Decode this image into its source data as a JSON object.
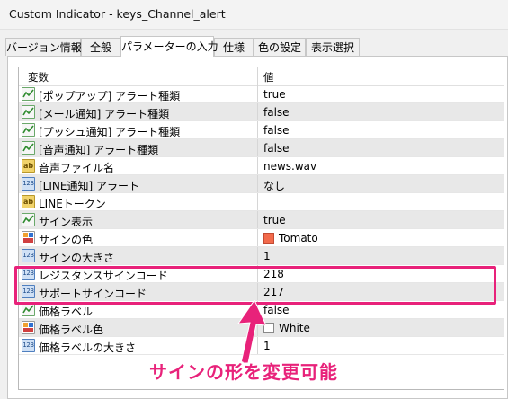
{
  "window": {
    "title": "Custom Indicator - keys_Channel_alert"
  },
  "tabs": [
    {
      "label": "バージョン情報"
    },
    {
      "label": "全般"
    },
    {
      "label": "パラメーターの入力"
    },
    {
      "label": "仕様"
    },
    {
      "label": "色の設定"
    },
    {
      "label": "表示選択"
    }
  ],
  "active_tab": "パラメーターの入力",
  "grid": {
    "headers": {
      "variable": "変数",
      "value": "値"
    },
    "rows": [
      {
        "type": "bool-icon",
        "name": "[ポップアップ] アラート種類",
        "value": "true"
      },
      {
        "type": "bool-icon",
        "name": "[メール通知] アラート種類",
        "value": "false"
      },
      {
        "type": "bool-icon",
        "name": "[プッシュ通知] アラート種類",
        "value": "false"
      },
      {
        "type": "bool-icon",
        "name": "[音声通知] アラート種類",
        "value": "false"
      },
      {
        "type": "string-icon",
        "name": "音声ファイル名",
        "value": "news.wav"
      },
      {
        "type": "number-icon",
        "name": "[LINE通知] アラート",
        "value": "なし"
      },
      {
        "type": "string-icon",
        "name": "LINEトークン",
        "value": ""
      },
      {
        "type": "bool-icon",
        "name": "サイン表示",
        "value": "true"
      },
      {
        "type": "color-icon",
        "name": "サインの色",
        "value": "Tomato",
        "swatch": "#f26a4b"
      },
      {
        "type": "number-icon",
        "name": "サインの大きさ",
        "value": "1"
      },
      {
        "type": "number-icon",
        "name": "レジスタンスサインコード",
        "value": "218"
      },
      {
        "type": "number-icon",
        "name": "サポートサインコード",
        "value": "217"
      },
      {
        "type": "bool-icon",
        "name": "価格ラベル",
        "value": "false"
      },
      {
        "type": "color-icon",
        "name": "価格ラベル色",
        "value": "White",
        "swatch": "#ffffff"
      },
      {
        "type": "number-icon",
        "name": "価格ラベルの大きさ",
        "value": "1"
      }
    ]
  },
  "icon_glyphs": {
    "string": "ab",
    "number": "123"
  },
  "annotation": {
    "text": "サインの形を変更可能",
    "color": "#e8227a"
  }
}
